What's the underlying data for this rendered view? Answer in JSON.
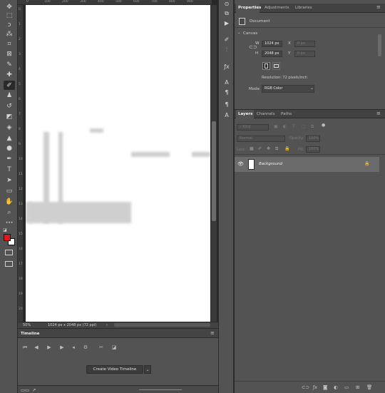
{
  "toolbar": {
    "tools": [
      {
        "name": "move-tool-icon",
        "glyph": "✥"
      },
      {
        "name": "marquee-tool-icon",
        "glyph": "⬚"
      },
      {
        "name": "lasso-tool-icon",
        "glyph": "ↄ"
      },
      {
        "name": "magic-wand-tool-icon",
        "glyph": "⁂"
      },
      {
        "name": "crop-tool-icon",
        "glyph": "⌗"
      },
      {
        "name": "frame-tool-icon",
        "glyph": "⊠"
      },
      {
        "name": "eyedropper-tool-icon",
        "glyph": "✎"
      },
      {
        "name": "healing-brush-tool-icon",
        "glyph": "✚"
      },
      {
        "name": "brush-tool-icon",
        "glyph": "✐"
      },
      {
        "name": "clone-stamp-tool-icon",
        "glyph": "♟"
      },
      {
        "name": "history-brush-tool-icon",
        "glyph": "↺"
      },
      {
        "name": "eraser-tool-icon",
        "glyph": "◩"
      },
      {
        "name": "paint-bucket-tool-icon",
        "glyph": "◈"
      },
      {
        "name": "blur-tool-icon",
        "glyph": "▲"
      },
      {
        "name": "dodge-tool-icon",
        "glyph": "●"
      },
      {
        "name": "pen-tool-icon",
        "glyph": "✒"
      },
      {
        "name": "type-tool-icon",
        "glyph": "T"
      },
      {
        "name": "path-selection-tool-icon",
        "glyph": "➤"
      },
      {
        "name": "rectangle-tool-icon",
        "glyph": "▭"
      },
      {
        "name": "hand-tool-icon",
        "glyph": "✋"
      },
      {
        "name": "zoom-tool-icon",
        "glyph": "⌕"
      },
      {
        "name": "more-tools-icon",
        "glyph": "•••"
      }
    ],
    "foreground_color": "#e0191b",
    "background_color": "#ffffff"
  },
  "ruler": {
    "top_ticks": [
      "0",
      "100",
      "200",
      "300",
      "400",
      "500",
      "600",
      "700",
      "800",
      "900"
    ],
    "left_ticks": [
      "0",
      "1",
      "2",
      "3",
      "4",
      "5",
      "6",
      "7",
      "8",
      "9",
      "10",
      "11",
      "12",
      "13",
      "14",
      "15",
      "16",
      "17",
      "18",
      "19",
      "20"
    ]
  },
  "status": {
    "zoom": "50%",
    "doc_info": "1024 px x 2048 px (72 ppi)",
    "arrow": "›"
  },
  "timeline": {
    "tab_label": "Timeline",
    "create_button": "Create Video Timeline",
    "dropdown_arrow": "⌄",
    "menu_glyph": "≡"
  },
  "properties": {
    "tabs": [
      "Properties",
      "Adjustments",
      "Libraries"
    ],
    "active_tab": "Properties",
    "document_label": "Document",
    "canvas_section": "Canvas",
    "width_label": "W",
    "width_value": "1024 px",
    "height_label": "H",
    "height_value": "2048 px",
    "x_label": "X",
    "x_value": "0 px",
    "y_label": "Y",
    "y_value": "0 px",
    "resolution": "Resolution: 72 pixels/inch",
    "mode_label": "Mode",
    "mode_value": "RGB Color"
  },
  "layers": {
    "tabs": [
      "Layers",
      "Channels",
      "Paths"
    ],
    "active_tab": "Layers",
    "filter_placeholder": "Kind",
    "blend_mode": "Normal",
    "opacity_label": "Opacity:",
    "opacity_value": "100%",
    "lock_label": "Lock:",
    "fill_label": "Fill:",
    "fill_value": "100%",
    "layer_name": "Background"
  }
}
